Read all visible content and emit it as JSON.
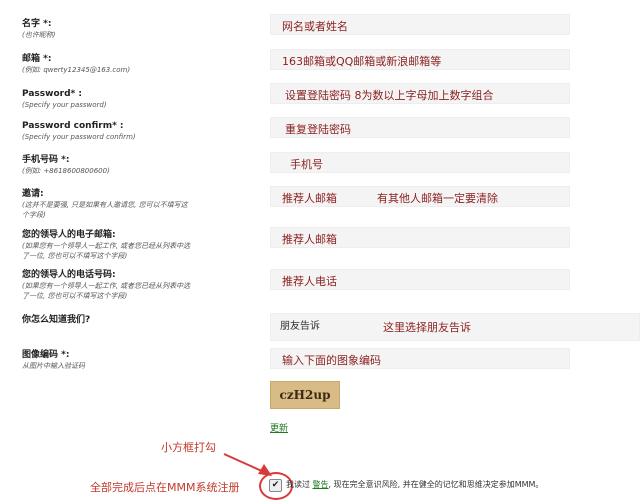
{
  "form": {
    "name": {
      "label": "名字 *:",
      "sub": "(也许昵称)",
      "placeholder": "网名或者姓名"
    },
    "email": {
      "label": "邮箱 *:",
      "sub": "(例如:   qwerty12345@163.com)",
      "placeholder": "163邮箱或QQ邮箱或新浪邮箱等"
    },
    "password": {
      "label": "Password* :",
      "sub": "(Specify your password)",
      "placeholder": "设置登陆密码  8为数以上字母加上数字组合"
    },
    "password_confirm": {
      "label": "Password confirm* :",
      "sub": "(Specify your password confirm)",
      "placeholder": "重复登陆密码"
    },
    "phone": {
      "label": "手机号码 *:",
      "sub": "(例如:   +8618600800600)",
      "placeholder": "手机号"
    },
    "invite": {
      "label": "邀请:",
      "sub1": "(这并不是要强, 只是如果有人邀请您, 您可以不填写这",
      "sub2": "个字段)",
      "placeholder": "推荐人邮箱",
      "note": "有其他人邮箱一定要清除"
    },
    "leader_email": {
      "label": "您的领导人的电子邮箱:",
      "sub1": "(如果您有一个领导人一起工作, 或者您已经从列表中选",
      "sub2": "了一位, 您也可以不填写这个字段)",
      "placeholder": "推荐人邮箱"
    },
    "leader_phone": {
      "label": "您的领导人的电话号码:",
      "sub1": "(如果您有一个领导人一起工作, 或者您已经从列表中选",
      "sub2": "了一位, 您也可以不填写这个字段)",
      "placeholder": "推荐人电话"
    },
    "source": {
      "label": "你怎么知道我们?",
      "value": "朋友告诉",
      "note": "这里选择朋友告诉"
    },
    "captcha": {
      "label": "图像编码 *:",
      "sub": "从图片中输入验证码",
      "placeholder": "输入下面的图象编码",
      "code": "czH2up",
      "refresh": "更新"
    }
  },
  "annotations": {
    "checkbox_hint": "小方框打勾",
    "finish_hint": "全部完成后点在MMM系统注册"
  },
  "agreement": {
    "check": "✔",
    "prefix": "我读过 ",
    "link": "警告",
    "suffix": ", 现在完全意识风险, 并在健全的记忆和思维决定参加MMM。"
  }
}
